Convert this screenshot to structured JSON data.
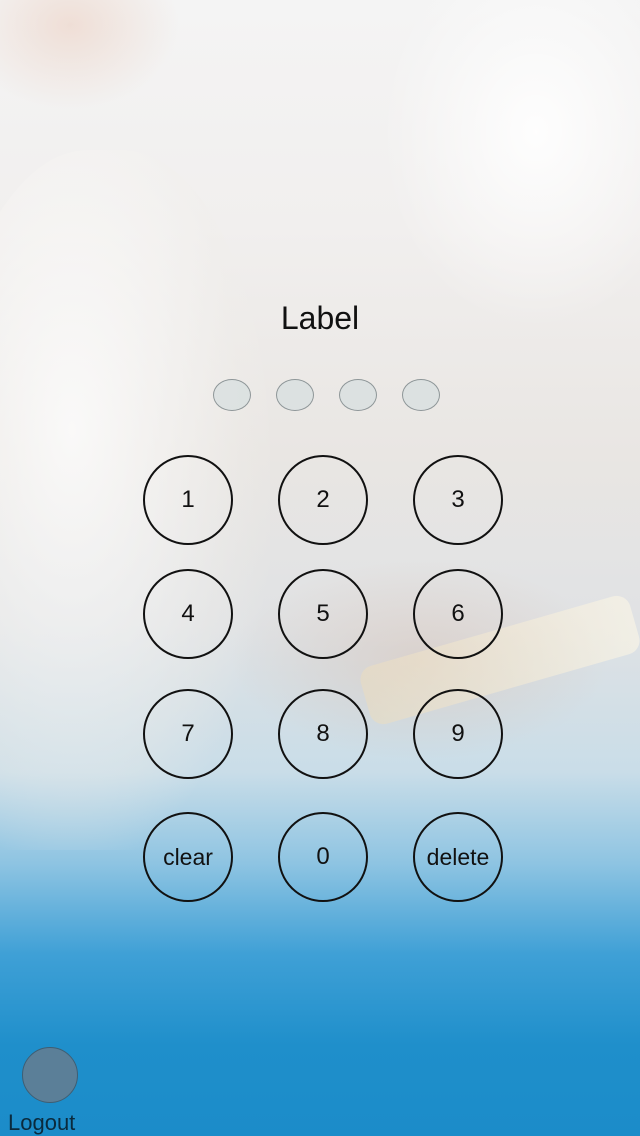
{
  "title": "Label",
  "passcode": {
    "length": 4,
    "filled": 0
  },
  "keypad": {
    "keys": [
      "1",
      "2",
      "3",
      "4",
      "5",
      "6",
      "7",
      "8",
      "9",
      "clear",
      "0",
      "delete"
    ]
  },
  "logout": {
    "label": "Logout"
  },
  "colors": {
    "accent": "#1b8cc9",
    "key_stroke": "#111111",
    "logout_button": "#5b7f98"
  }
}
